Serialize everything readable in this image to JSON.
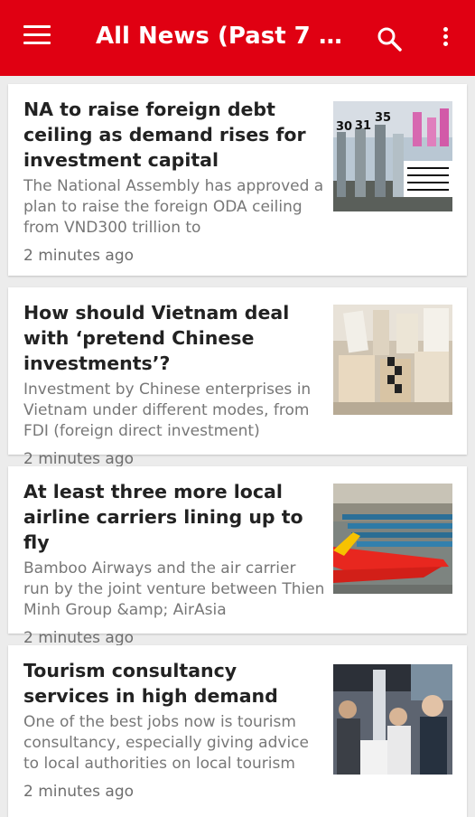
{
  "appbar": {
    "title": "All News (Past 7 Da…",
    "bg_color": "#e00012",
    "menu_icon": "hamburger-menu-icon",
    "search_icon": "search-icon",
    "more_icon": "more-vert-icon"
  },
  "articles": [
    {
      "title": "NA to raise foreign debt ceiling as demand rises for investment capital",
      "summary": "The National Assembly has approved a plan to raise the foreign ODA ceiling from VND300 trillion to",
      "time": "2 minutes ago",
      "thumb_labels": [
        "30",
        "31",
        "35"
      ]
    },
    {
      "title": "How should Vietnam deal with ‘pretend Chinese investments’?",
      "summary": "Investment by Chinese enterprises in Vietnam under different modes, from FDI (foreign direct investment)",
      "time": "2 minutes ago"
    },
    {
      "title": "At least three more local airline carriers lining up to fly",
      "summary": "Bamboo Airways and the air carrier run by the joint venture between Thien Minh Group &amp; AirAsia",
      "time": "2 minutes ago"
    },
    {
      "title": "Tourism consultancy services in high demand",
      "summary": "One of the best jobs now is tourism consultancy, especially giving advice to local authorities on local tourism",
      "time": "2 minutes ago"
    }
  ]
}
